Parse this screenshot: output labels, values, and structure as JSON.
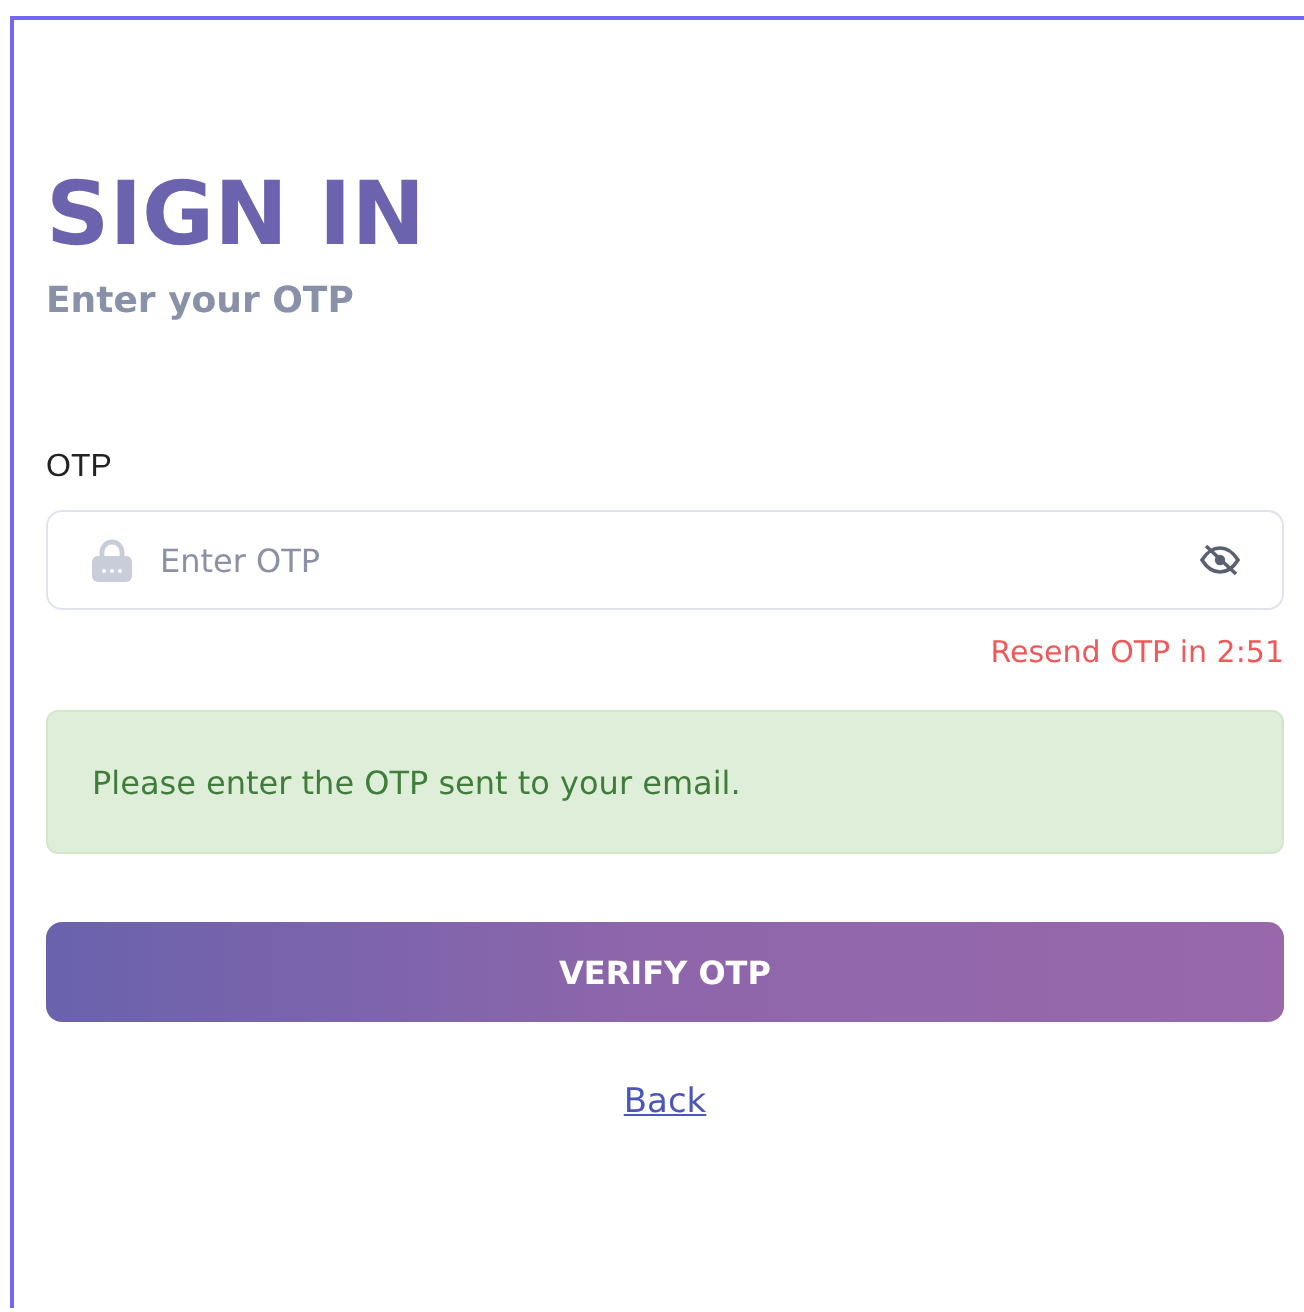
{
  "heading": {
    "title": "SIGN IN",
    "subtitle": "Enter your OTP"
  },
  "otp_field": {
    "label": "OTP",
    "placeholder": "Enter OTP",
    "resend_text": "Resend OTP in 2:51"
  },
  "alert": {
    "kind": "success",
    "message": "Please enter the OTP sent to your email."
  },
  "verify_button": {
    "label": "VERIFY OTP"
  },
  "back_link": {
    "label": "Back"
  }
}
